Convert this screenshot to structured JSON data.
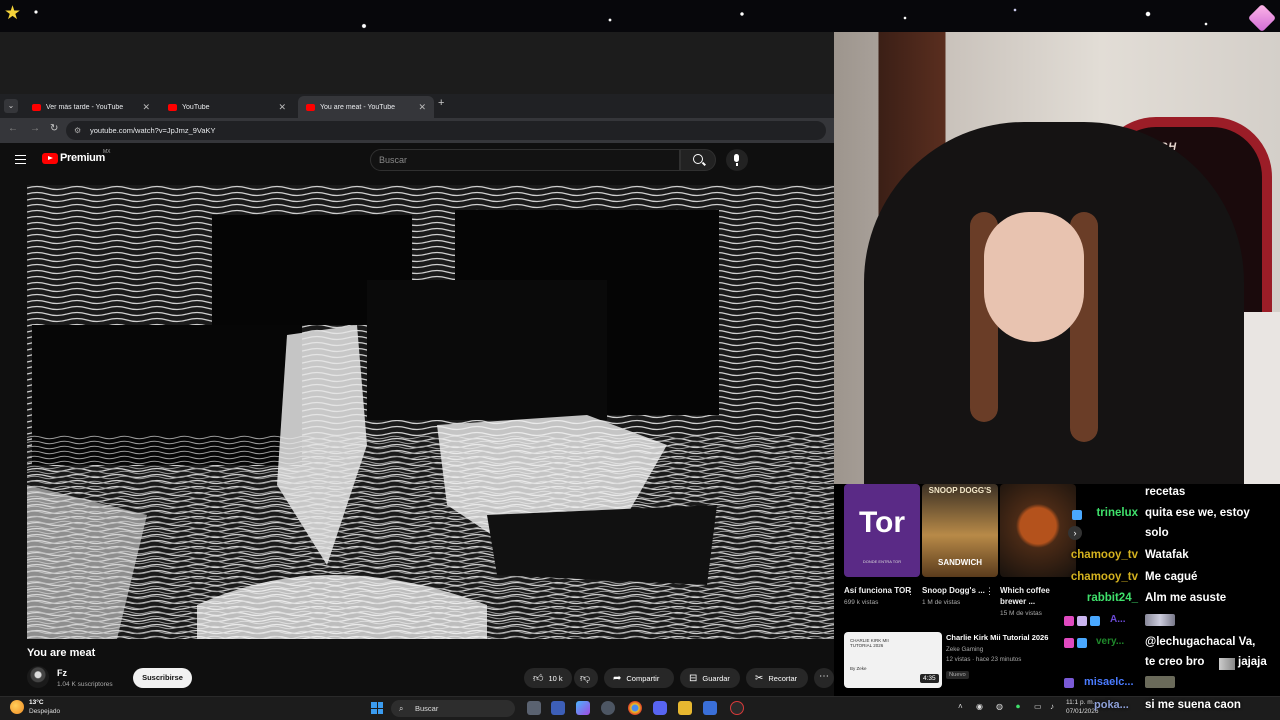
{
  "browser": {
    "tabs": [
      {
        "title": "Ver más tarde - YouTube",
        "active": false
      },
      {
        "title": "YouTube",
        "active": false
      },
      {
        "title": "You are meat - YouTube",
        "active": true
      }
    ],
    "new_tab": "+",
    "url": "youtube.com/watch?v=JpJmz_9VaKY"
  },
  "youtube": {
    "brand": "Premium",
    "region": "MX",
    "search_placeholder": "Buscar",
    "video": {
      "title": "You are meat",
      "channel": "Fz",
      "subscribers": "1.04 K suscriptores",
      "subscribe_label": "Suscribirse",
      "likes": "10 k",
      "share_label": "Compartir",
      "save_label": "Guardar",
      "clip_label": "Recortar"
    }
  },
  "webcam": {
    "chair_text": "CLUTCH ZOOM"
  },
  "recommendations": [
    {
      "title": "Así funciona TOR",
      "views": "699 k vistas",
      "thumb_text": "Tor",
      "thumb_caption": "DONDE ENTRA TOR"
    },
    {
      "title": "Snoop Dogg's ...",
      "views": "1 M de vistas",
      "thumb_text": "SNOOP DOGG'S",
      "thumb_caption": "SANDWICH"
    },
    {
      "title": "Which coffee brewer ...",
      "views": "15 M de vistas"
    }
  ],
  "rec_long": {
    "title": "Charlie Kirk Mii Tutorial 2026",
    "channel": "Zeke Gaming",
    "meta": "12 vistas · hace 23 minutos",
    "badge": "Nuevo",
    "duration": "4:35",
    "thumb_lines": [
      "CHARLIE KIRK MII",
      "TUTORIAL 2026",
      "By Zeke"
    ]
  },
  "chat": [
    {
      "name": "",
      "msg": "recetas",
      "color": "#ffffff"
    },
    {
      "name": "trinelux",
      "msg": "quita ese we, estoy",
      "color": "#3fe06b"
    },
    {
      "name": "",
      "msg": "solo",
      "color": "#ffffff"
    },
    {
      "name": "chamooy_tv",
      "msg": "Watafak",
      "color": "#d4b21f"
    },
    {
      "name": "chamooy_tv",
      "msg": "Me cagué",
      "color": "#d4b21f"
    },
    {
      "name": "rabbit24_",
      "msg": "Alm me asuste",
      "color": "#3fe06b"
    },
    {
      "name": "A...",
      "msg": "",
      "color": "#6b4ad6"
    },
    {
      "name": "very...",
      "msg": "@lechugachacal Va,",
      "color": "#1f8a2b"
    },
    {
      "name": "",
      "msg": "te creo bro",
      "color": "#ffffff",
      "suffix": "jajaja"
    },
    {
      "name": "misaelc...",
      "msg": "",
      "color": "#4a7bff"
    },
    {
      "name": "poka...",
      "msg": "si me suena caon",
      "color": "#8ea0d8"
    }
  ],
  "taskbar": {
    "weather_temp": "13°C",
    "weather_desc": "Despejado",
    "search_placeholder": "Buscar",
    "time": "11:1 p. m.",
    "date": "07/01/2026"
  },
  "colors": {
    "youtube_red": "#ff0000",
    "chair_red": "#9b1d27",
    "chat_green": "#3fe06b",
    "chat_gold": "#d4b21f"
  }
}
